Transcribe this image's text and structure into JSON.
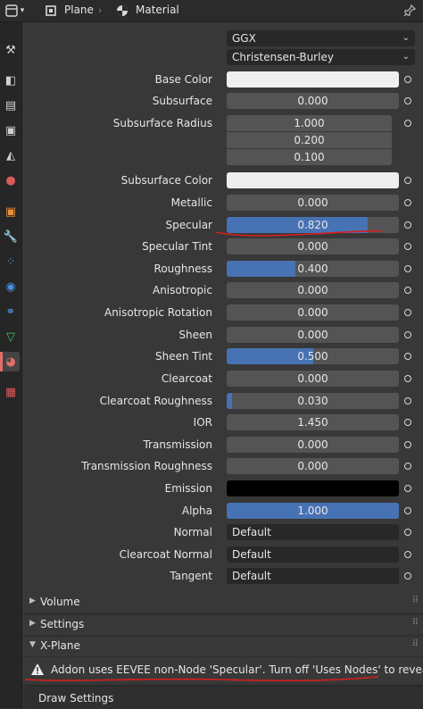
{
  "header": {
    "object_name": "Plane",
    "separator": "›",
    "tab_name": "Material"
  },
  "sidebar": {
    "tabs": [
      {
        "name": "tool",
        "icon": "wrench-screwdriver-icon",
        "glyph": "⚒",
        "color": "#d0d0d0"
      },
      {
        "name": "render",
        "icon": "camera-icon",
        "glyph": "◧",
        "color": "#d0d0d0"
      },
      {
        "name": "output",
        "icon": "printer-icon",
        "glyph": "▤",
        "color": "#d0d0d0"
      },
      {
        "name": "view-layer",
        "icon": "image-stack-icon",
        "glyph": "▣",
        "color": "#d0d0d0"
      },
      {
        "name": "scene",
        "icon": "scene-icon",
        "glyph": "◭",
        "color": "#d0d0d0"
      },
      {
        "name": "world",
        "icon": "world-icon",
        "glyph": "●",
        "color": "#d75a5a"
      },
      {
        "name": "object",
        "icon": "object-icon",
        "glyph": "▣",
        "color": "#e8903a"
      },
      {
        "name": "modifiers",
        "icon": "wrench-icon",
        "glyph": "🔧",
        "color": "#4f8fd6"
      },
      {
        "name": "particles",
        "icon": "particles-icon",
        "glyph": "⁘",
        "color": "#4f8fd6"
      },
      {
        "name": "physics",
        "icon": "physics-icon",
        "glyph": "◉",
        "color": "#4f8fd6"
      },
      {
        "name": "constraints",
        "icon": "constraint-icon",
        "glyph": "⚭",
        "color": "#4f8fd6"
      },
      {
        "name": "data",
        "icon": "mesh-data-icon",
        "glyph": "▽",
        "color": "#3fc46a"
      },
      {
        "name": "material",
        "icon": "material-icon",
        "glyph": "◕",
        "color": "#e66c6c",
        "active": true
      },
      {
        "name": "texture",
        "icon": "checker-texture-icon",
        "glyph": "▦",
        "color": "#d75a5a"
      }
    ]
  },
  "material": {
    "distribution": "GGX",
    "subsurface_method": "Christensen-Burley",
    "rows": [
      {
        "label": "Base Color",
        "kind": "color",
        "color": "#efefef"
      },
      {
        "label": "Subsurface",
        "kind": "slider",
        "value": "0.000",
        "fraction": 0
      },
      {
        "label": "Subsurface Radius",
        "kind": "vector",
        "values": [
          "1.000",
          "0.200",
          "0.100"
        ]
      },
      {
        "label": "Subsurface Color",
        "kind": "color",
        "color": "#efefef"
      },
      {
        "label": "Metallic",
        "kind": "slider",
        "value": "0.000",
        "fraction": 0
      },
      {
        "label": "Specular",
        "kind": "slider",
        "value": "0.820",
        "fraction": 0.82
      },
      {
        "label": "Specular Tint",
        "kind": "slider",
        "value": "0.000",
        "fraction": 0
      },
      {
        "label": "Roughness",
        "kind": "slider",
        "value": "0.400",
        "fraction": 0.4
      },
      {
        "label": "Anisotropic",
        "kind": "slider",
        "value": "0.000",
        "fraction": 0
      },
      {
        "label": "Anisotropic Rotation",
        "kind": "slider",
        "value": "0.000",
        "fraction": 0
      },
      {
        "label": "Sheen",
        "kind": "slider",
        "value": "0.000",
        "fraction": 0
      },
      {
        "label": "Sheen Tint",
        "kind": "slider",
        "value": "0.500",
        "fraction": 0.5
      },
      {
        "label": "Clearcoat",
        "kind": "slider",
        "value": "0.000",
        "fraction": 0
      },
      {
        "label": "Clearcoat Roughness",
        "kind": "slider",
        "value": "0.030",
        "fraction": 0.03
      },
      {
        "label": "IOR",
        "kind": "slider",
        "value": "1.450",
        "fraction": 0
      },
      {
        "label": "Transmission",
        "kind": "slider",
        "value": "0.000",
        "fraction": 0
      },
      {
        "label": "Transmission Roughness",
        "kind": "slider",
        "value": "0.000",
        "fraction": 0
      },
      {
        "label": "Emission",
        "kind": "color",
        "color": "#000000"
      },
      {
        "label": "Alpha",
        "kind": "slider",
        "value": "1.000",
        "fraction": 1
      },
      {
        "label": "Normal",
        "kind": "link",
        "value": "Default"
      },
      {
        "label": "Clearcoat Normal",
        "kind": "link",
        "value": "Default"
      },
      {
        "label": "Tangent",
        "kind": "link",
        "value": "Default"
      }
    ]
  },
  "sections": [
    {
      "title": "Volume",
      "expanded": false
    },
    {
      "title": "Settings",
      "expanded": false
    },
    {
      "title": "X-Plane",
      "expanded": true
    }
  ],
  "warning": {
    "text": "Addon uses EEVEE non-Node 'Specular'. Turn off 'Uses Nodes' to reveal."
  },
  "draw_settings": {
    "title": "Draw Settings"
  },
  "colors": {
    "accent": "#4772b3",
    "annotation": "#d81e1e",
    "active_tab": "#e66c6c"
  }
}
